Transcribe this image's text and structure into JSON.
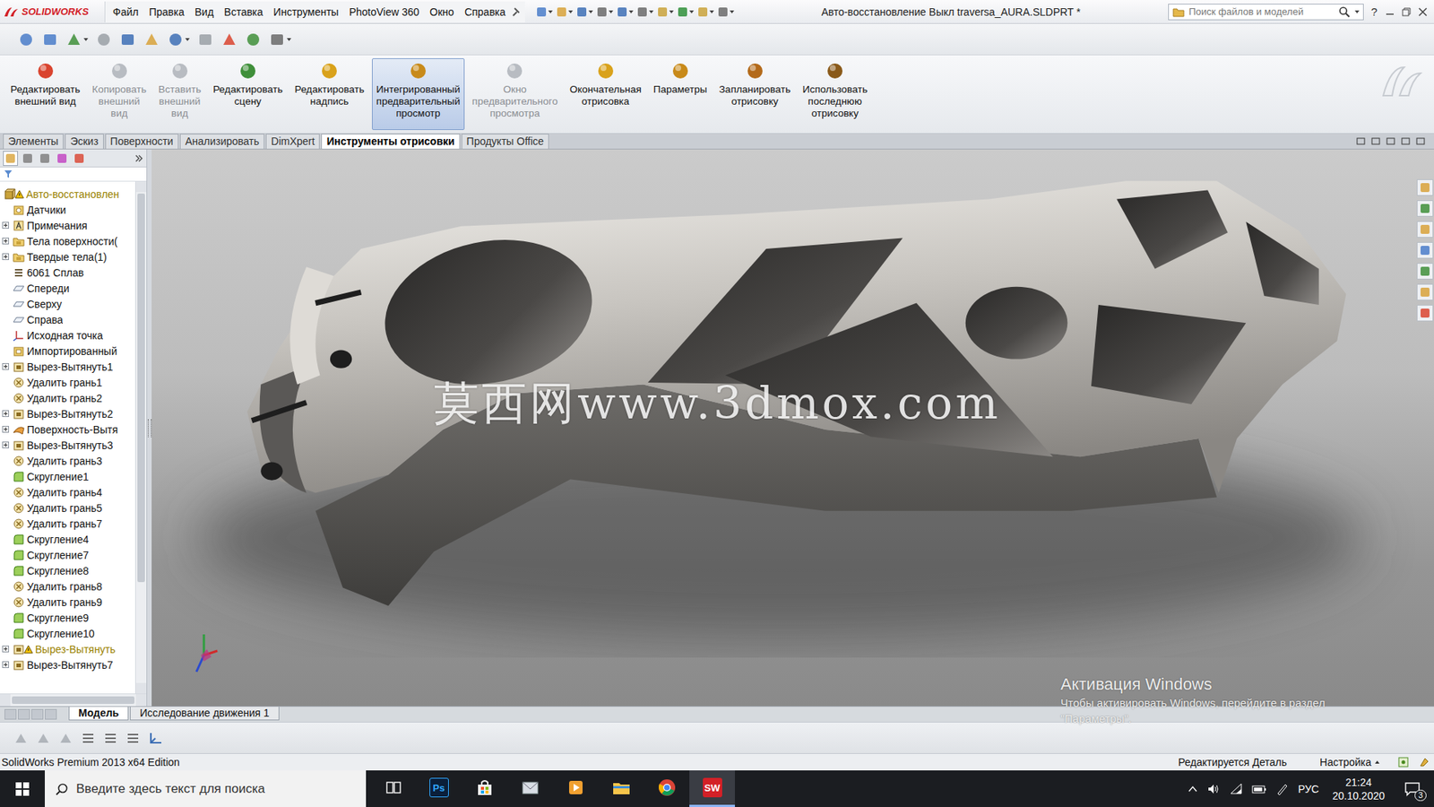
{
  "app": {
    "logo": "SOLIDWORKS",
    "help": "?"
  },
  "menu": [
    "Файл",
    "Правка",
    "Вид",
    "Вставка",
    "Инструменты",
    "PhotoView 360",
    "Окно",
    "Справка"
  ],
  "window": {
    "title": "Авто-восстановление Выкл traversa_AURA.SLDPRT *"
  },
  "search": {
    "placeholder": "Поиск файлов и моделей"
  },
  "ribbon": [
    {
      "lines": [
        "Редактировать",
        "внешний вид"
      ],
      "disabled": false,
      "selected": false
    },
    {
      "lines": [
        "Копировать",
        "внешний",
        "вид"
      ],
      "disabled": true,
      "selected": false
    },
    {
      "lines": [
        "Вставить",
        "внешний",
        "вид"
      ],
      "disabled": true,
      "selected": false
    },
    {
      "lines": [
        "Редактировать",
        "сцену"
      ],
      "disabled": false,
      "selected": false
    },
    {
      "lines": [
        "Редактировать",
        "надпись"
      ],
      "disabled": false,
      "selected": false
    },
    {
      "lines": [
        "Интегрированный",
        "предварительный",
        "просмотр"
      ],
      "disabled": false,
      "selected": true
    },
    {
      "lines": [
        "Окно",
        "предварительного",
        "просмотра"
      ],
      "disabled": true,
      "selected": false
    },
    {
      "lines": [
        "Окончательная",
        "отрисовка"
      ],
      "disabled": false,
      "selected": false
    },
    {
      "lines": [
        "Параметры"
      ],
      "disabled": false,
      "selected": false
    },
    {
      "lines": [
        "Запланировать",
        "отрисовку"
      ],
      "disabled": false,
      "selected": false
    },
    {
      "lines": [
        "Использовать",
        "последнюю",
        "отрисовку"
      ],
      "disabled": false,
      "selected": false
    }
  ],
  "command_tabs": [
    {
      "label": "Элементы",
      "selected": false
    },
    {
      "label": "Эскиз",
      "selected": false
    },
    {
      "label": "Поверхности",
      "selected": false
    },
    {
      "label": "Анализировать",
      "selected": false
    },
    {
      "label": "DimXpert",
      "selected": false
    },
    {
      "label": "Инструменты отрисовки",
      "selected": true
    },
    {
      "label": "Продукты Office",
      "selected": false
    }
  ],
  "tree": {
    "items": [
      {
        "label": "Авто-восстановлен",
        "kind": "part",
        "expandable": false,
        "warning": true,
        "root": true
      },
      {
        "label": "Датчики",
        "kind": "sensor",
        "expandable": false,
        "warning": false,
        "root": false
      },
      {
        "label": "Примечания",
        "kind": "annotation",
        "expandable": true,
        "warning": false,
        "root": false
      },
      {
        "label": "Тела поверхности(",
        "kind": "folder",
        "expandable": true,
        "warning": false,
        "root": false
      },
      {
        "label": "Твердые тела(1)",
        "kind": "folder",
        "expandable": true,
        "warning": false,
        "root": false
      },
      {
        "label": "6061 Сплав",
        "kind": "material",
        "expandable": false,
        "warning": false,
        "root": false
      },
      {
        "label": "Спереди",
        "kind": "plane",
        "expandable": false,
        "warning": false,
        "root": false
      },
      {
        "label": "Сверху",
        "kind": "plane",
        "expandable": false,
        "warning": false,
        "root": false
      },
      {
        "label": "Справа",
        "kind": "plane",
        "expandable": false,
        "warning": false,
        "root": false
      },
      {
        "label": "Исходная точка",
        "kind": "origin",
        "expandable": false,
        "warning": false,
        "root": false
      },
      {
        "label": "Импортированный",
        "kind": "import",
        "expandable": false,
        "warning": false,
        "root": false
      },
      {
        "label": "Вырез-Вытянуть1",
        "kind": "cut",
        "expandable": true,
        "warning": false,
        "root": false
      },
      {
        "label": "Удалить грань1",
        "kind": "delete",
        "expandable": false,
        "warning": false,
        "root": false
      },
      {
        "label": "Удалить грань2",
        "kind": "delete",
        "expandable": false,
        "warning": false,
        "root": false
      },
      {
        "label": "Вырез-Вытянуть2",
        "kind": "cut",
        "expandable": true,
        "warning": false,
        "root": false
      },
      {
        "label": "Поверхность-Вытя",
        "kind": "surface",
        "expandable": true,
        "warning": false,
        "root": false
      },
      {
        "label": "Вырез-Вытянуть3",
        "kind": "cut",
        "expandable": true,
        "warning": false,
        "root": false
      },
      {
        "label": "Удалить грань3",
        "kind": "delete",
        "expandable": false,
        "warning": false,
        "root": false
      },
      {
        "label": "Скругление1",
        "kind": "fillet",
        "expandable": false,
        "warning": false,
        "root": false
      },
      {
        "label": "Удалить грань4",
        "kind": "delete",
        "expandable": false,
        "warning": false,
        "root": false
      },
      {
        "label": "Удалить грань5",
        "kind": "delete",
        "expandable": false,
        "warning": false,
        "root": false
      },
      {
        "label": "Удалить грань7",
        "kind": "delete",
        "expandable": false,
        "warning": false,
        "root": false
      },
      {
        "label": "Скругление4",
        "kind": "fillet",
        "expandable": false,
        "warning": false,
        "root": false
      },
      {
        "label": "Скругление7",
        "kind": "fillet",
        "expandable": false,
        "warning": false,
        "root": false
      },
      {
        "label": "Скругление8",
        "kind": "fillet",
        "expandable": false,
        "warning": false,
        "root": false
      },
      {
        "label": "Удалить грань8",
        "kind": "delete",
        "expandable": false,
        "warning": false,
        "root": false
      },
      {
        "label": "Удалить грань9",
        "kind": "delete",
        "expandable": false,
        "warning": false,
        "root": false
      },
      {
        "label": "Скругление9",
        "kind": "fillet",
        "expandable": false,
        "warning": false,
        "root": false
      },
      {
        "label": "Скругление10",
        "kind": "fillet",
        "expandable": false,
        "warning": false,
        "root": false
      },
      {
        "label": "Вырез-Вытянуть",
        "kind": "cut",
        "expandable": true,
        "warning": true,
        "root": false
      },
      {
        "label": "Вырез-Вытянуть7",
        "kind": "cut",
        "expandable": true,
        "warning": false,
        "root": false
      }
    ]
  },
  "viewport": {
    "watermark": "莫西网www.3dmox.com"
  },
  "activation": {
    "title": "Активация Windows",
    "lines": [
      "Чтобы активировать Windows, перейдите в раздел",
      "\"Параметры\"."
    ]
  },
  "bottom_tabs": [
    {
      "label": "Модель",
      "selected": true
    },
    {
      "label": "Исследование движения 1",
      "selected": false
    }
  ],
  "status_bar": {
    "product": "SolidWorks Premium 2013 x64 Edition",
    "mode": "Редактируется Деталь",
    "settings": "Настройка"
  },
  "taskbar": {
    "search_placeholder": "Введите здесь текст для поиска",
    "apps": [
      {
        "kind": "task-view",
        "active": false
      },
      {
        "kind": "photoshop",
        "label": "Ps",
        "active": false
      },
      {
        "kind": "store",
        "active": false
      },
      {
        "kind": "mail",
        "active": false
      },
      {
        "kind": "media",
        "active": false
      },
      {
        "kind": "explorer",
        "active": false
      },
      {
        "kind": "chrome",
        "active": false
      },
      {
        "kind": "solidworks",
        "label": "SW",
        "active": true
      }
    ],
    "language": "РУС",
    "time": "21:24",
    "date": "20.10.2020",
    "notifications": "3"
  }
}
